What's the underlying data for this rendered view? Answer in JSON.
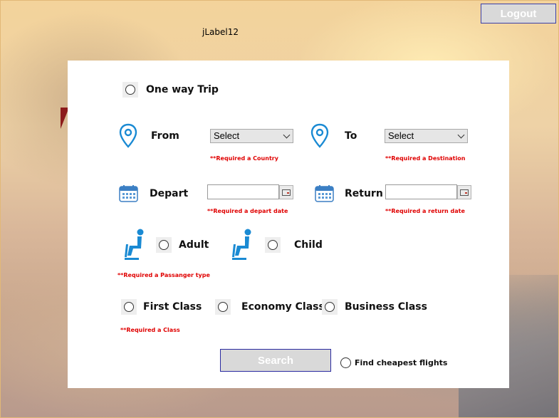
{
  "window": {
    "title_label": "jLabel12"
  },
  "header": {
    "logout_label": "Logout"
  },
  "trip": {
    "one_way_label": "One way Trip"
  },
  "from": {
    "label": "From",
    "selected": "Select",
    "error": "**Required a Country"
  },
  "to": {
    "label": "To",
    "selected": "Select",
    "error": "**Required a Destination"
  },
  "depart": {
    "label": "Depart",
    "value": "",
    "error": "**Required a depart date"
  },
  "return": {
    "label": "Return",
    "value": "",
    "error": "**Required a return date"
  },
  "passenger": {
    "adult_label": "Adult",
    "child_label": "Child",
    "error": "**Required a Passanger type"
  },
  "class": {
    "first_label": "First Class",
    "economy_label": "Economy Class",
    "business_label": "Business Class",
    "error": "**Required a Class"
  },
  "actions": {
    "search_label": "Search",
    "cheapest_label": "Find cheapest flights"
  },
  "colors": {
    "accent_blue": "#1a8ad3",
    "error_red": "#e00000",
    "button_gray": "#d9d9d9",
    "button_border": "#2a2aa0"
  },
  "icons": {
    "location": "map-pin-icon",
    "calendar": "calendar-icon",
    "seat": "seated-passenger-icon"
  }
}
